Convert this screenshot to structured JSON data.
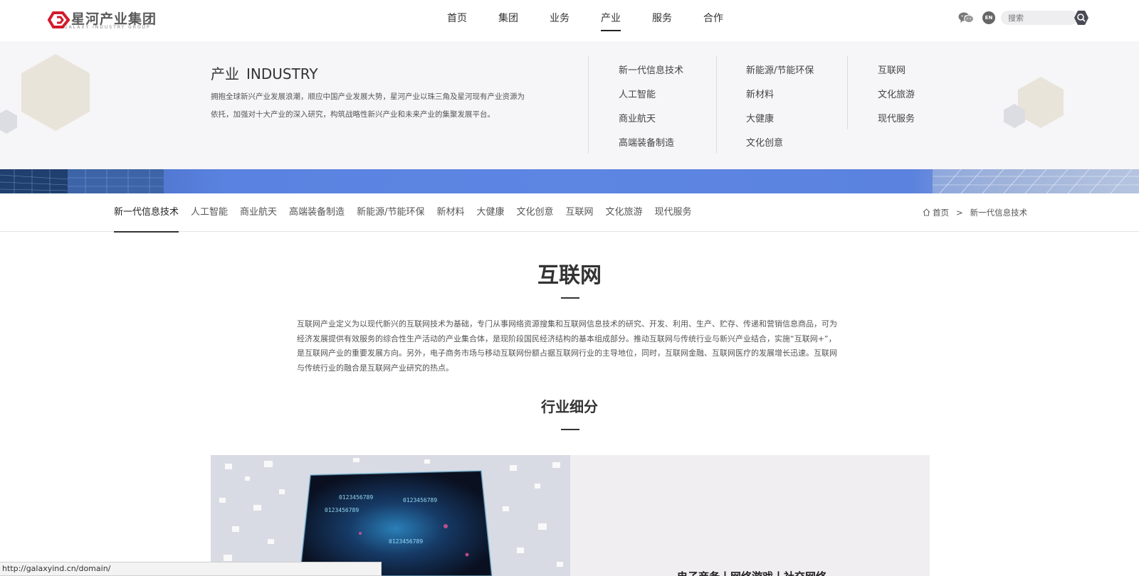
{
  "header": {
    "logo_text": "星河产业集团",
    "logo_sub": "GALAXY INDUSTRY GROUP",
    "nav": [
      "首页",
      "集团",
      "业务",
      "产业",
      "服务",
      "合作"
    ],
    "active_nav": "产业",
    "lang_label": "EN",
    "search_placeholder": "搜索"
  },
  "panel": {
    "title_cn": "产业",
    "title_en": "INDUSTRY",
    "description": "拥抱全球新兴产业发展浪潮，顺应中国产业发展大势，星河产业以珠三角及星河现有产业资源为依托，加强对十大产业的深入研究，构筑战略性新兴产业和未来产业的集聚发展平台。",
    "col1": [
      "新一代信息技术",
      "人工智能",
      "商业航天",
      "高端装备制造"
    ],
    "col2": [
      "新能源/节能环保",
      "新材料",
      "大健康",
      "文化创意"
    ],
    "col3": [
      "互联网",
      "文化旅游",
      "现代服务"
    ]
  },
  "subnav": {
    "items": [
      "新一代信息技术",
      "人工智能",
      "商业航天",
      "高端装备制造",
      "新能源/节能环保",
      "新材料",
      "大健康",
      "文化创意",
      "互联网",
      "文化旅游",
      "现代服务"
    ],
    "active": "新一代信息技术"
  },
  "breadcrumb": {
    "home": "首页",
    "separator": ">",
    "current": "新一代信息技术"
  },
  "main": {
    "title": "互联网",
    "intro": "互联网产业定义为以现代新兴的互联网技术为基础，专门从事网络资源搜集和互联网信息技术的研究、开发、利用、生产、贮存、传递和营销信息商品，可为经济发展提供有效服务的综合性生产活动的产业集合体，是现阶段国民经济结构的基本组成部分。推动互联网与传统行业与新兴产业结合，实施“互联网+”，是互联网产业的重要发展方向。另外，电子商务市场与移动互联网份额占据互联网行业的主导地位，同时，互联网金融、互联网医疗的发展增长迅速。互联网与传统行业的融合是互联网产业研究的热点。",
    "section_title": "行业细分",
    "card_title": "电子商务丨网络游戏丨社交网络"
  },
  "status_url": "http://galaxyind.cn/domain/"
}
